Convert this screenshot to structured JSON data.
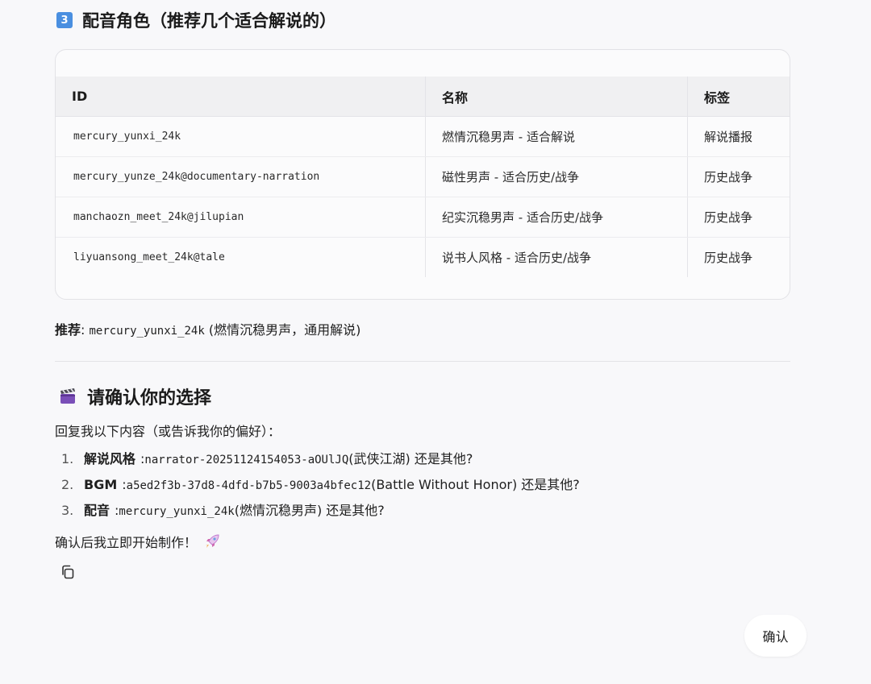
{
  "section1": {
    "badge": "3",
    "title": "配音角色（推荐几个适合解说的）"
  },
  "voice_table": {
    "headers": [
      "ID",
      "名称",
      "标签"
    ],
    "rows": [
      [
        "mercury_yunxi_24k",
        "燃情沉稳男声 - 适合解说",
        "解说播报"
      ],
      [
        "mercury_yunze_24k@documentary-narration",
        "磁性男声 - 适合历史/战争",
        "历史战争"
      ],
      [
        "manchaozn_meet_24k@jilupian",
        "纪实沉稳男声 - 适合历史/战争",
        "历史战争"
      ],
      [
        "liyuansong_meet_24k@tale",
        "说书人风格 - 适合历史/战争",
        "历史战争"
      ]
    ]
  },
  "recommend": {
    "label": "推荐",
    "colon": ": ",
    "id": "mercury_yunxi_24k",
    "note": " (燃情沉稳男声，通用解说)"
  },
  "section2": {
    "icon": "clapperboard-icon",
    "title": "请确认你的选择"
  },
  "intro": "回复我以下内容（或告诉我你的偏好）：",
  "choices": [
    {
      "num": "1.",
      "label": "解说风格",
      "colon": ": ",
      "code": "narrator-20251124154053-aOUlJQ",
      "note": " (武侠江湖) 还是其他?"
    },
    {
      "num": "2.",
      "label": "BGM",
      "colon": ": ",
      "code": "a5ed2f3b-37d8-4dfd-b7b5-9003a4bfec12",
      "note": " (Battle Without Honor) 还是其他?"
    },
    {
      "num": "3.",
      "label": "配音",
      "colon": ": ",
      "code": "mercury_yunxi_24k",
      "note": " (燃情沉稳男声) 还是其他?"
    }
  ],
  "final_text": "确认后我立即开始制作！",
  "final_icon": "rocket-icon",
  "copy_icon": "copy-icon",
  "confirm_button": "确认",
  "colors": {
    "badge": "#4a8fe0",
    "background": "#f8f8fa"
  }
}
